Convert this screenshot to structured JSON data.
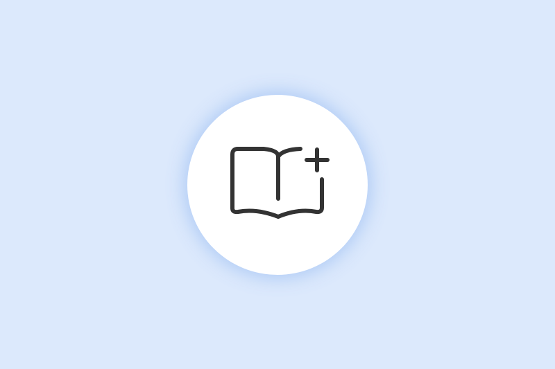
{
  "colors": {
    "background": "#dce9fc",
    "button_fill": "#ffffff",
    "button_glow": "#aac8f5",
    "icon_stroke": "#333333"
  },
  "add_book_button": {
    "icon": "book-open-plus-icon"
  }
}
